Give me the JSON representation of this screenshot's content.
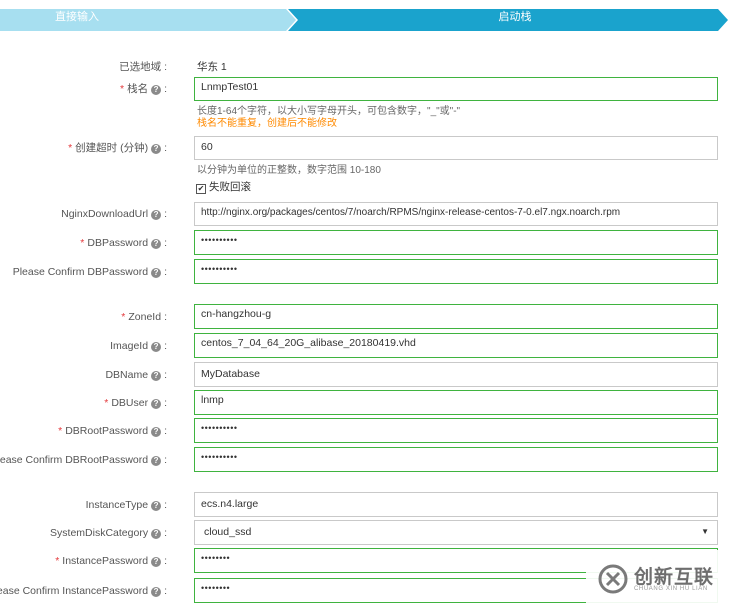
{
  "steps": [
    {
      "label": "直接输入",
      "active": false
    },
    {
      "label": "启动栈",
      "active": true
    }
  ],
  "colors": {
    "inactive_step": "#a7dff0",
    "active_step": "#1aa3cd",
    "valid_border": "#3fb33f",
    "required": "#e4393c",
    "warning": "#ff8a00"
  },
  "form": {
    "region": {
      "label": "已选地域",
      "value": "华东 1"
    },
    "stack_name": {
      "label": "栈名",
      "value": "LnmpTest01",
      "hint": "长度1-64个字符，以大小写字母开头，可包含数字，\"_\"或\"-\"",
      "warning": "栈名不能重复，创建后不能修改"
    },
    "timeout": {
      "label": "创建超时 (分钟)",
      "value": "60",
      "hint": "以分钟为单位的正整数，数字范围 10-180",
      "rollback_label": "失败回滚",
      "rollback_checked": true
    },
    "nginx_url": {
      "label": "NginxDownloadUrl",
      "value": "http://nginx.org/packages/centos/7/noarch/RPMS/nginx-release-centos-7-0.el7.ngx.noarch.rpm"
    },
    "db_password": {
      "label": "DBPassword",
      "value": "••••••••••"
    },
    "db_password_confirm": {
      "label": "Please Confirm DBPassword",
      "value": "••••••••••"
    },
    "zone_id": {
      "label": "ZoneId",
      "value": "cn-hangzhou-g"
    },
    "image_id": {
      "label": "ImageId",
      "value": "centos_7_04_64_20G_alibase_20180419.vhd"
    },
    "db_name": {
      "label": "DBName",
      "value": "MyDatabase"
    },
    "db_user": {
      "label": "DBUser",
      "value": "lnmp"
    },
    "db_root_password": {
      "label": "DBRootPassword",
      "value": "••••••••••"
    },
    "db_root_password_confirm": {
      "label": "Please Confirm DBRootPassword",
      "value": "••••••••••"
    },
    "instance_type": {
      "label": "InstanceType",
      "value": "ecs.n4.large"
    },
    "system_disk_category": {
      "label": "SystemDiskCategory",
      "value": "cloud_ssd"
    },
    "instance_password": {
      "label": "InstancePassword",
      "value": "••••••••"
    },
    "instance_password_confirm": {
      "label": "Please Confirm InstancePassword",
      "value": "••••••••"
    }
  },
  "watermark": {
    "cn": "创新互联",
    "en": "CHUANG XIN HU LIAN"
  }
}
